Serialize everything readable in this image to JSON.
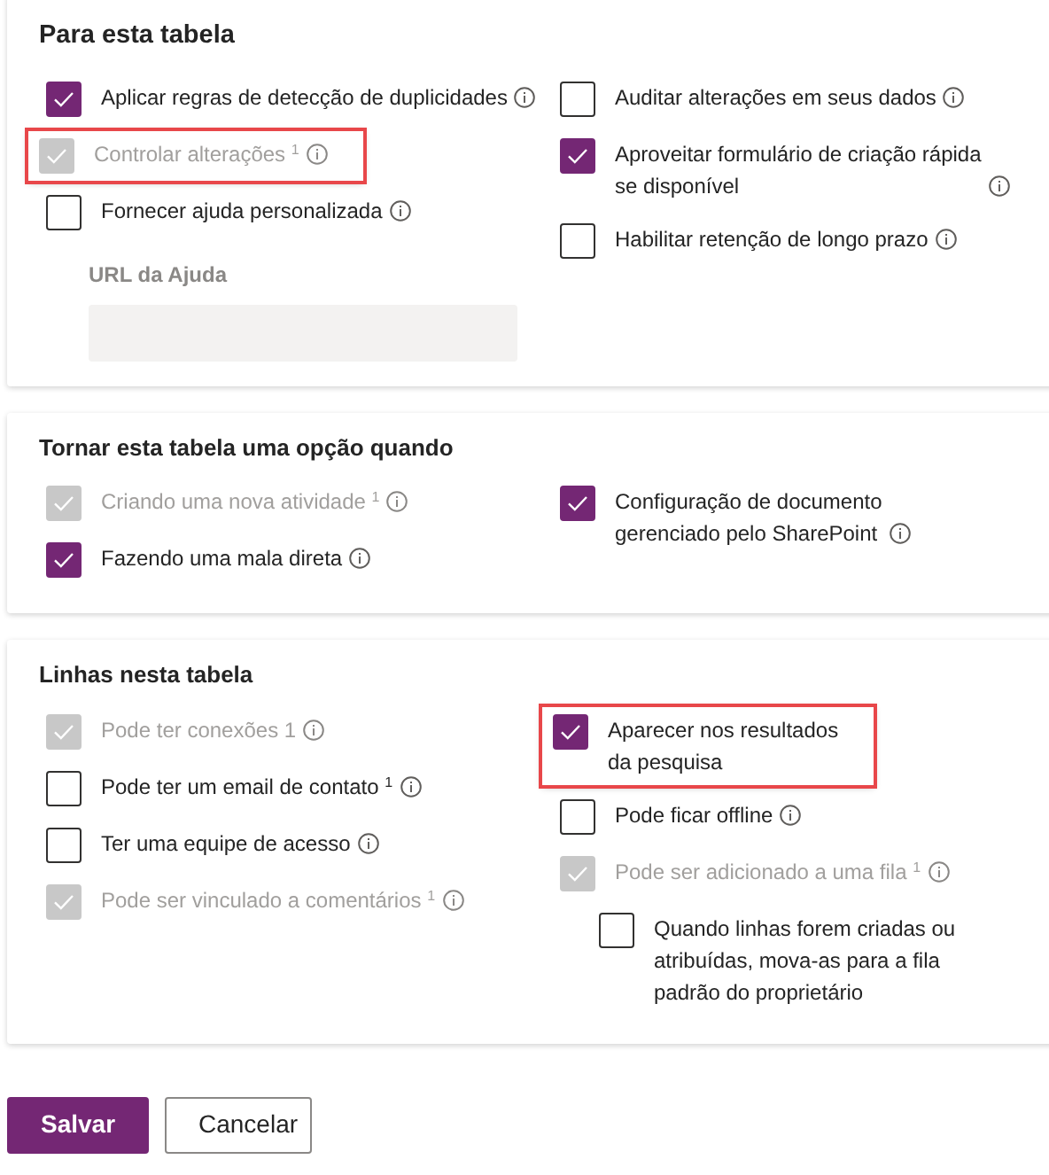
{
  "sections": [
    {
      "title": "Para esta tabela",
      "left": [
        {
          "label": "Aplicar regras de detecção de duplicidades",
          "checked": true,
          "disabled": false,
          "info": true,
          "highlighted": false
        },
        {
          "label": "Controlar alterações $^{1}$",
          "checked": true,
          "disabled": true,
          "info": true,
          "highlighted": true
        },
        {
          "label": "Fornecer ajuda personalizada",
          "checked": false,
          "disabled": false,
          "info": true,
          "highlighted": false,
          "field": {
            "label": "URL da Ajuda",
            "disabled": true
          }
        }
      ],
      "right": [
        {
          "label": "Auditar alterações em seus dados",
          "checked": false,
          "disabled": false,
          "info": true,
          "highlighted": false
        },
        {
          "label": "Aproveitar formulário de criação rápida\nse disponível",
          "checked": true,
          "disabled": false,
          "info": true,
          "highlighted": false
        },
        {
          "label": "Habilitar retenção de longo prazo",
          "checked": false,
          "disabled": false,
          "info": true,
          "highlighted": false
        }
      ]
    },
    {
      "title": "Tornar esta tabela uma opção quando",
      "left": [
        {
          "label": "Criando uma nova atividade $^{1}$",
          "checked": true,
          "disabled": true,
          "info": true,
          "highlighted": false
        },
        {
          "label": "Fazendo uma mala direta",
          "checked": true,
          "disabled": false,
          "info": true,
          "highlighted": false
        }
      ],
      "right": [
        {
          "label": "Configuração de documento\ngerenciado pelo SharePoint",
          "checked": true,
          "disabled": false,
          "info": true,
          "highlighted": false
        }
      ]
    },
    {
      "title": "Linhas nesta tabela",
      "left": [
        {
          "label": "Pode ter conexões 1",
          "checked": true,
          "disabled": true,
          "info": true,
          "highlighted": false
        },
        {
          "label": "Pode ter um email de contato $^{1}$",
          "checked": false,
          "disabled": false,
          "info": true,
          "highlighted": false
        },
        {
          "label": "Ter uma equipe de acesso",
          "checked": false,
          "disabled": false,
          "info": true,
          "highlighted": false
        },
        {
          "label": "Pode ser vinculado a comentários $^{1}$",
          "checked": true,
          "disabled": true,
          "info": true,
          "highlighted": false
        }
      ],
      "right": [
        {
          "label": "Aparecer nos resultados\nda pesquisa",
          "checked": true,
          "disabled": false,
          "info": false,
          "highlighted": true
        },
        {
          "label": "Pode ficar offline",
          "checked": false,
          "disabled": false,
          "info": true,
          "highlighted": false
        },
        {
          "label": "Pode ser adicionado a uma fila $^{1}$",
          "checked": true,
          "disabled": true,
          "info": true,
          "highlighted": false,
          "children": [
            {
              "label": "Quando linhas forem criadas ou\natribuídas, mova-as para a fila\npadrão do proprietário",
              "checked": false,
              "disabled": false,
              "info": false,
              "highlighted": false
            }
          ]
        }
      ]
    }
  ],
  "buttons": [
    {
      "label": "Salvar",
      "kind": "primary"
    },
    {
      "label": "Cancelar",
      "kind": "secondary"
    }
  ]
}
